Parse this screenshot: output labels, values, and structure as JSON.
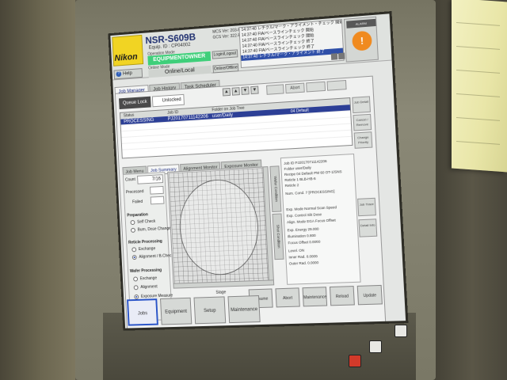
{
  "header": {
    "brand": "Nikon",
    "model": "NSR-S609B",
    "equip_id": "Equip. ID : CP04002",
    "operation_mode_label": "Operation Mode",
    "operation_mode": "EQUIPMENTOWNER",
    "online_mode_label": "Online Mode",
    "online_mode": "Online/Local",
    "login_button": "Login/Logout",
    "online_offline_button": "Online/Offline",
    "help_button": "Help",
    "info_lines": [
      "MCS Ver: 203-P11",
      "GCS Ver: 322-P09"
    ],
    "alarm_button": "ALARM",
    "alarm_icon": "!"
  },
  "messages": [
    "14:37:40 レチクル/マーク・アライメント・チェック 開始",
    "14:37:40 FIA/ベースラインチェック 開始",
    "14:37:40 FIA/ベースラインチェック 開始",
    "14:37:40 FIA/ベースラインチェック 終了",
    "14:37:40 FIA/ベースラインチェック 終了",
    "14:37:40 レチクル/マーク・アライメント 終了"
  ],
  "tabs": [
    "Job Manager",
    "Job History",
    "Task Scheduler"
  ],
  "queue": {
    "lock_button": "Queue Lock",
    "lock_state": "Unlocked",
    "nav_arrows": [
      "▲",
      "▲",
      "▼",
      "▼"
    ],
    "toolbar": [
      "",
      "Abort",
      "",
      ""
    ],
    "columns": [
      "Status",
      "Job ID",
      "Folder on Job Tree",
      ""
    ],
    "rows": [
      {
        "status": "PROCESSING",
        "job_id": "PJ20170711142206",
        "folder": "user/Daily",
        "extra": "04 Default"
      }
    ],
    "side_buttons": [
      "Job Detail",
      "Cancel / Remove",
      "Change Priority"
    ]
  },
  "subtabs": [
    "Job Menu",
    "Job Summary",
    "Alignment Monitor",
    "Exposure Monitor"
  ],
  "counts": {
    "count_label": "Count",
    "count_value": "7/16",
    "processed_label": "Processed",
    "failed_label": "Failed"
  },
  "preparation": {
    "title": "Preparation",
    "options": [
      "Self Check",
      "Burn, Dose Change"
    ]
  },
  "reticle": {
    "title": "Reticle Processing",
    "options": [
      "Exchange",
      "Alignment / B.Check"
    ]
  },
  "wafer": {
    "title": "Wafer Processing",
    "options": [
      "Exchange",
      "Alignment",
      "Exposure Measure"
    ],
    "selected": "Exposure Measure",
    "selected_reticle": "Alignment / B.Check"
  },
  "vertical_tabs": [
    "Wafer Condition",
    "Shot Condition"
  ],
  "detail_lines": [
    "Job ID    PJ20170711142206",
    "Folder    user/Daily",
    "Recipe    04 Default PM 60 OT-1/SNS",
    "Reticle 1  BLB-HB-6",
    "Reticle 2",
    "Num. Cond.  7 [PROCESSING]",
    "Exp. Mode   Normal     Scan Speed",
    "Exp. Control  Slit      Dose",
    "Align. Mode  EGA       Focus Offset",
    "Exp. Energy  29.000",
    "Illumination  0.800",
    "Focus Offset  0.0000",
    "Level.  ON",
    "Inner Rad.  0.0000",
    "Outer Rad.  0.0000"
  ],
  "detail_side_buttons": [
    "Job Trace",
    "Detail Info"
  ],
  "wafer_map": {
    "move_label": "Stage"
  },
  "mid_buttons": [
    "Resume",
    "Abort",
    "Maintenance",
    "Reload",
    "Update"
  ],
  "bottom_buttons": [
    "Jobs",
    "Equipment",
    "Setup",
    "Maintenance"
  ],
  "colors": {
    "accent_blue": "#2c3f96",
    "mode_green": "#3fcf7a",
    "logo_yellow": "#f1d423",
    "alarm_orange": "#f08a1f"
  }
}
